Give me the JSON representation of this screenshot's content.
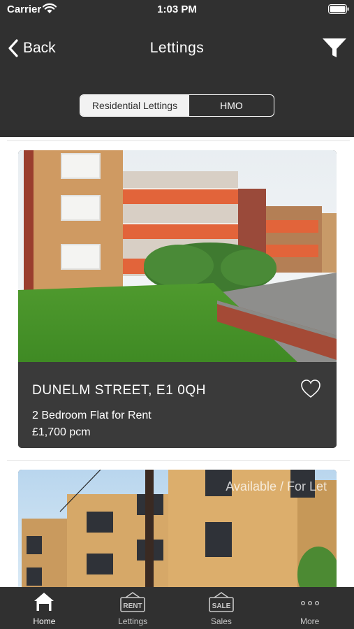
{
  "status_bar": {
    "carrier": "Carrier",
    "time": "1:03 PM"
  },
  "nav": {
    "back_label": "Back",
    "title": "Lettings"
  },
  "segments": [
    {
      "label": "Residential Lettings",
      "selected": true
    },
    {
      "label": "HMO",
      "selected": false
    }
  ],
  "listings": [
    {
      "address": "DUNELM STREET, E1 0QH",
      "description": "2 Bedroom Flat for Rent",
      "price": "£1,700 pcm",
      "favorited": false
    },
    {
      "status_overlay": "Available / For Let"
    }
  ],
  "tabs": [
    {
      "label": "Home",
      "icon": "home-icon",
      "icon_text": "",
      "active": true
    },
    {
      "label": "Lettings",
      "icon": "rent-sign-icon",
      "icon_text": "RENT",
      "active": false
    },
    {
      "label": "Sales",
      "icon": "sale-sign-icon",
      "icon_text": "SALE",
      "active": false
    },
    {
      "label": "More",
      "icon": "more-dots-icon",
      "icon_text": "",
      "active": false
    }
  ],
  "colors": {
    "header_bg": "#303030",
    "card_bg": "#3a3a3a",
    "segment_active_bg": "#f2f2f2"
  }
}
